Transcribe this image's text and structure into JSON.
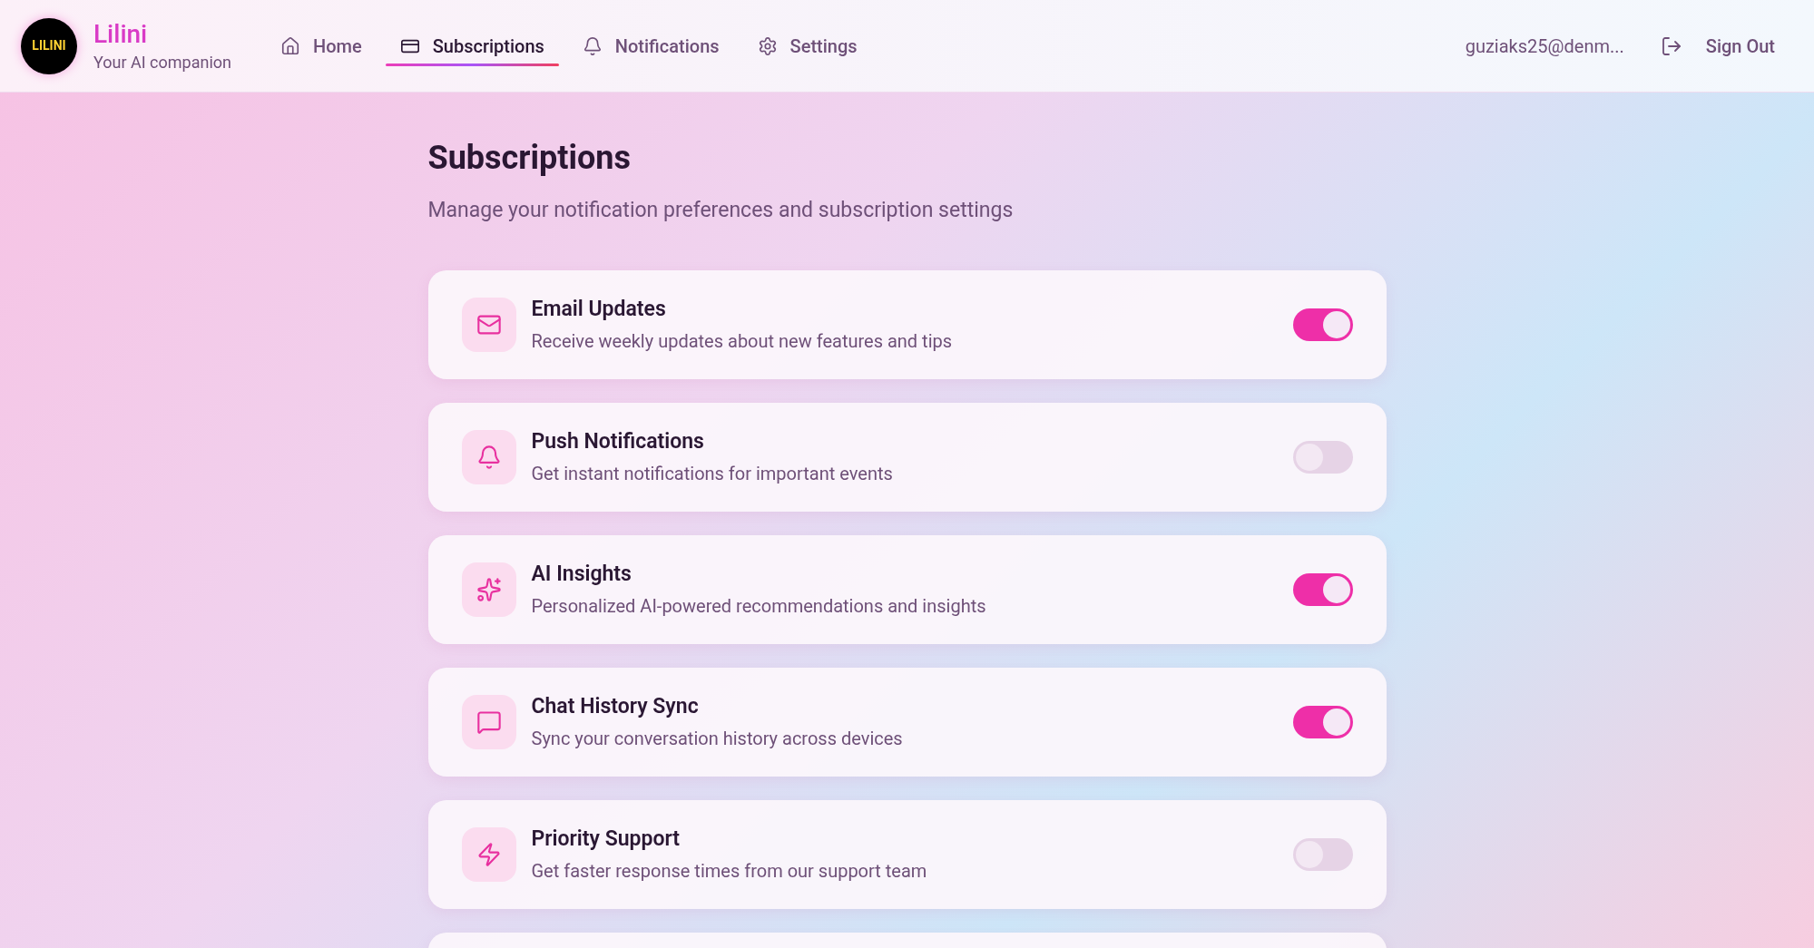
{
  "brand": {
    "logo": "LILINI",
    "name": "Lilini",
    "tagline": "Your AI companion"
  },
  "nav": [
    {
      "label": "Home",
      "selected": false
    },
    {
      "label": "Subscriptions",
      "selected": true
    },
    {
      "label": "Notifications",
      "selected": false
    },
    {
      "label": "Settings",
      "selected": false
    }
  ],
  "user": {
    "email": "guziaks25@denm...",
    "sign_out": "Sign Out"
  },
  "page": {
    "title": "Subscriptions",
    "subtitle": "Manage your notification preferences and subscription settings"
  },
  "settings": [
    {
      "title": "Email Updates",
      "description": "Receive weekly updates about new features and tips",
      "on": true
    },
    {
      "title": "Push Notifications",
      "description": "Get instant notifications for important events",
      "on": false
    },
    {
      "title": "AI Insights",
      "description": "Personalized AI-powered recommendations and insights",
      "on": true
    },
    {
      "title": "Chat History Sync",
      "description": "Sync your conversation history across devices",
      "on": true
    },
    {
      "title": "Priority Support",
      "description": "Get faster response times from our support team",
      "on": false
    }
  ]
}
